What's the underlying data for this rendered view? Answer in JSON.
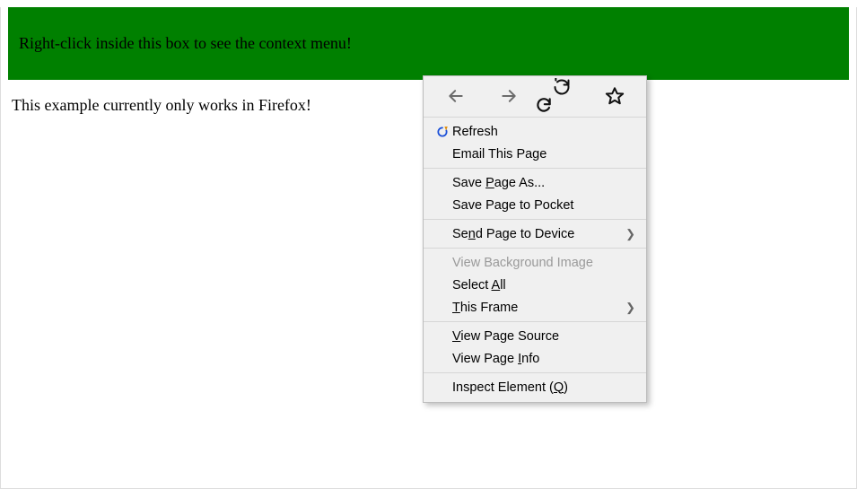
{
  "green_box": {
    "text": "Right-click inside this box to see the context menu!"
  },
  "body_text": "This example currently only works in Firefox!",
  "context_menu": {
    "items": {
      "refresh": "Refresh",
      "email": "Email This Page",
      "save_as_pre": "Save ",
      "save_as_u": "P",
      "save_as_post": "age As...",
      "save_pocket": "Save Page to Pocket",
      "send_device_pre": "Se",
      "send_device_u": "n",
      "send_device_post": "d Page to Device",
      "view_bg": "View Background Image",
      "select_all_pre": "Select ",
      "select_all_u": "A",
      "select_all_post": "ll",
      "this_frame_u": "T",
      "this_frame_post": "his Frame",
      "view_source_u": "V",
      "view_source_post": "iew Page Source",
      "view_info_pre": "View Page ",
      "view_info_u": "I",
      "view_info_post": "nfo",
      "inspect_pre": "Inspect Element (",
      "inspect_u": "Q",
      "inspect_post": ")"
    }
  }
}
